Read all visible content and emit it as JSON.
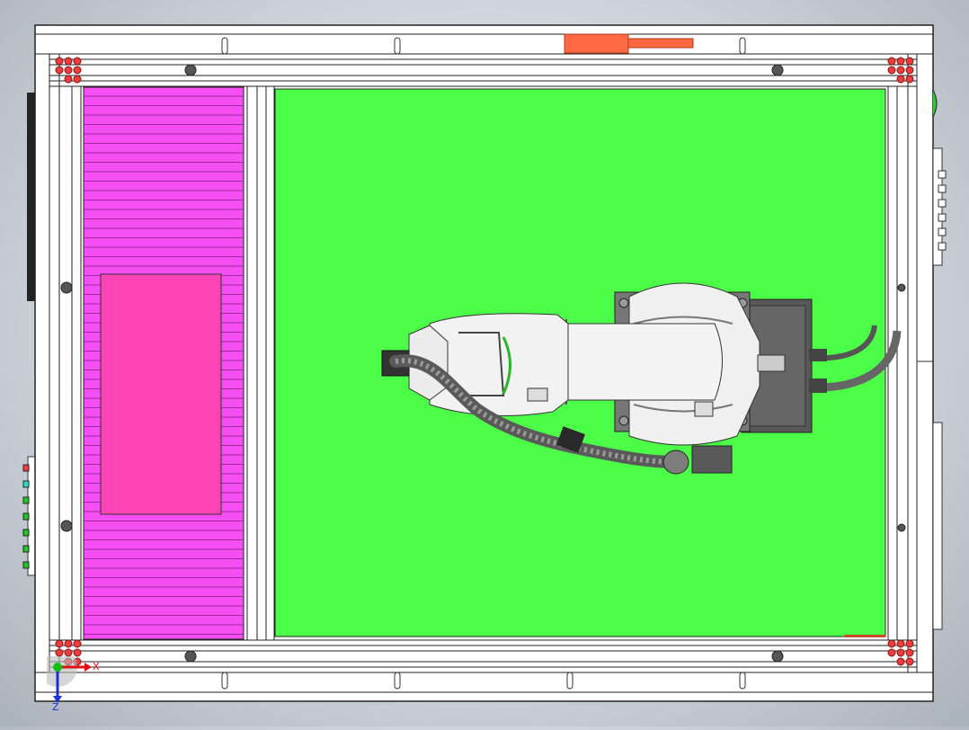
{
  "scene": {
    "description_free": true,
    "colors": {
      "background": "#cdd3da",
      "frame": "#ffffff",
      "frame_line": "#222222",
      "floor": "#4dfe48",
      "conveyor": "#f54ef2",
      "conveyor_pad": "#ff45b5",
      "bolt": "#ee3b3b",
      "orange_part": "#ff6a45",
      "robot_body": "#f2f2f2",
      "robot_shadow": "#b5b5b5",
      "cable": "#6e6e6e",
      "controller": "#585858"
    },
    "icons": [
      "view-triad-icon",
      "status-led-icon"
    ]
  },
  "triad": {
    "x_label": "X",
    "z_label": "Z",
    "x_color": "#e01010",
    "z_color": "#1a30d8",
    "origin_color": "#10c010"
  },
  "leds": {
    "colors": [
      "#ff3a3a",
      "#26e0c8",
      "#22c822",
      "#22c822",
      "#22c822",
      "#22c822",
      "#22c822"
    ]
  }
}
